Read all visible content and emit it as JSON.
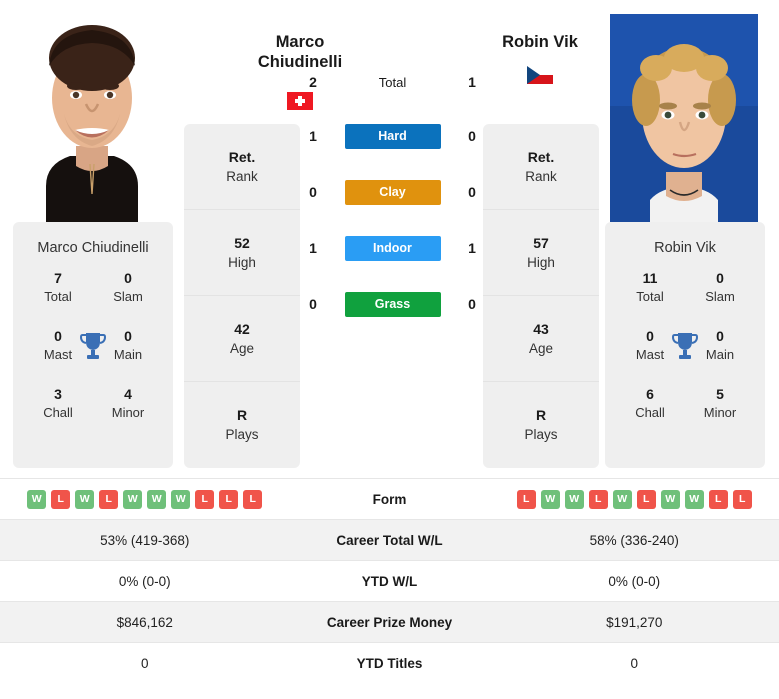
{
  "players": {
    "left": {
      "name": "Marco Chiudinelli",
      "name_line1": "Marco",
      "name_line2": "Chiudinelli",
      "country": "Switzerland",
      "flag": "swiss-flag",
      "photo_alt": "marco-chiudinelli-photo",
      "rank": "Ret.",
      "rank_label": "Rank",
      "high": "52",
      "high_label": "High",
      "age": "42",
      "age_label": "Age",
      "plays": "R",
      "plays_label": "Plays",
      "titles": {
        "total": "7",
        "total_label": "Total",
        "slam": "0",
        "slam_label": "Slam",
        "mast": "0",
        "mast_label": "Mast",
        "main": "0",
        "main_label": "Main",
        "chall": "3",
        "chall_label": "Chall",
        "minor": "4",
        "minor_label": "Minor"
      },
      "h2h": {
        "total": "2",
        "hard": "1",
        "clay": "0",
        "indoor": "1",
        "grass": "0"
      },
      "form": [
        "W",
        "L",
        "W",
        "L",
        "W",
        "W",
        "W",
        "L",
        "L",
        "L"
      ],
      "career_total_wl": "53% (419-368)",
      "ytd_wl": "0% (0-0)",
      "career_prize_money": "$846,162",
      "ytd_titles": "0"
    },
    "right": {
      "name": "Robin Vik",
      "name_line1": "Robin Vik",
      "name_line2": "",
      "country": "Czech Republic",
      "flag": "czech-flag",
      "photo_alt": "robin-vik-photo",
      "rank": "Ret.",
      "rank_label": "Rank",
      "high": "57",
      "high_label": "High",
      "age": "43",
      "age_label": "Age",
      "plays": "R",
      "plays_label": "Plays",
      "titles": {
        "total": "11",
        "total_label": "Total",
        "slam": "0",
        "slam_label": "Slam",
        "mast": "0",
        "mast_label": "Mast",
        "main": "0",
        "main_label": "Main",
        "chall": "6",
        "chall_label": "Chall",
        "minor": "5",
        "minor_label": "Minor"
      },
      "h2h": {
        "total": "1",
        "hard": "0",
        "clay": "0",
        "indoor": "1",
        "grass": "0"
      },
      "form": [
        "L",
        "W",
        "W",
        "L",
        "W",
        "L",
        "W",
        "W",
        "L",
        "L"
      ],
      "career_total_wl": "58% (336-240)",
      "ytd_wl": "0% (0-0)",
      "career_prize_money": "$191,270",
      "ytd_titles": "0"
    }
  },
  "surfaces": {
    "total_label": "Total",
    "hard_label": "Hard",
    "clay_label": "Clay",
    "indoor_label": "Indoor",
    "grass_label": "Grass",
    "colors": {
      "hard": "#0b72bd",
      "clay": "#e0920e",
      "indoor": "#2a9df4",
      "grass": "#10a13e"
    }
  },
  "table": {
    "form_label": "Form",
    "career_total_wl_label": "Career Total W/L",
    "ytd_wl_label": "YTD W/L",
    "career_prize_money_label": "Career Prize Money",
    "ytd_titles_label": "YTD Titles"
  },
  "theme": {
    "card_bg": "#efefef",
    "row_shaded": "#f2f2f2",
    "win_color": "#6fc07a",
    "loss_color": "#f0544a",
    "trophy_color": "#3a6fb5"
  }
}
